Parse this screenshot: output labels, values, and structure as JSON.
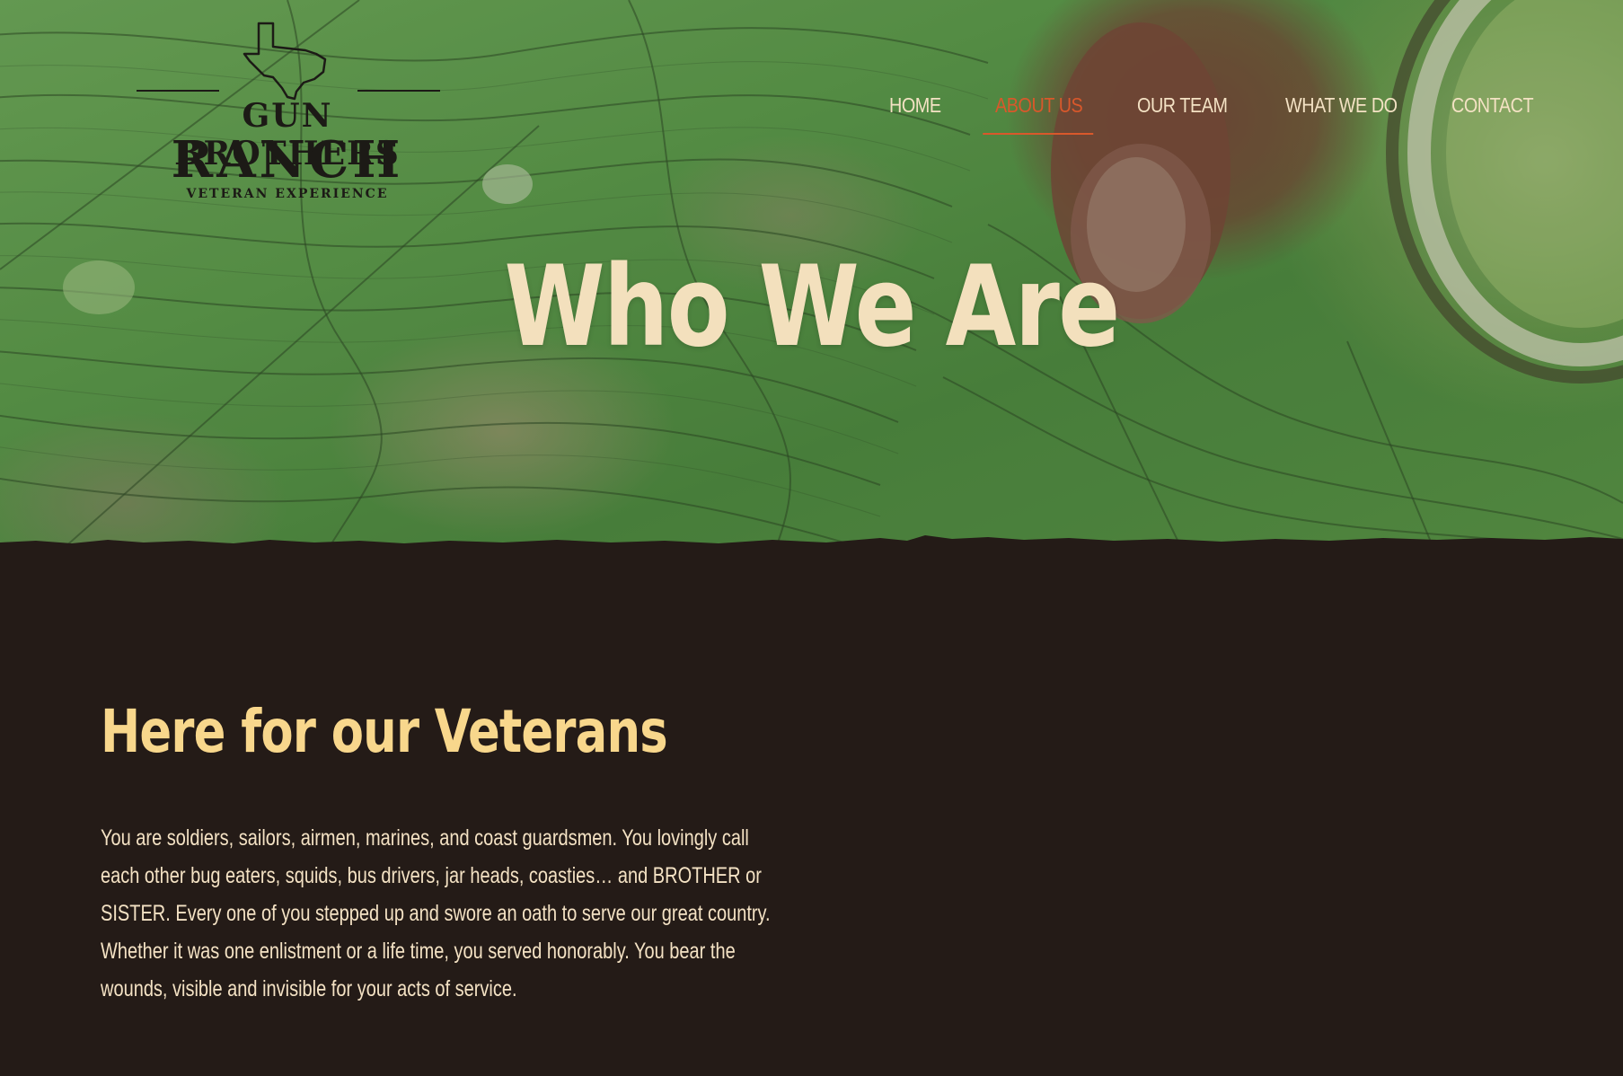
{
  "logo": {
    "line1": "GUN BROTHERS",
    "line2": "RANCH",
    "line3": "VETERAN EXPERIENCE"
  },
  "nav": {
    "items": [
      {
        "label": "HOME",
        "active": false
      },
      {
        "label": "ABOUT US",
        "active": true
      },
      {
        "label": "OUR TEAM",
        "active": false
      },
      {
        "label": "WHAT WE DO",
        "active": false
      },
      {
        "label": "CONTACT",
        "active": false
      }
    ]
  },
  "hero": {
    "title": "Who We Are"
  },
  "section": {
    "heading": "Here for our Veterans",
    "body": "You are soldiers, sailors, airmen, marines, and coast guardsmen. You lovingly call each other bug eaters, squids, bus drivers, jar heads, coasties… and BROTHER or SISTER. Every one of you stepped up and swore an oath to serve our great country. Whether it was one enlistment or a life time, you served honorably. You bear the wounds, visible and invisible for your acts of service."
  },
  "colors": {
    "background": "#241b17",
    "heading": "#f8d78c",
    "text": "#f4e2c4",
    "nav_active": "#d9582b",
    "hero_title": "#f3e0bd"
  }
}
